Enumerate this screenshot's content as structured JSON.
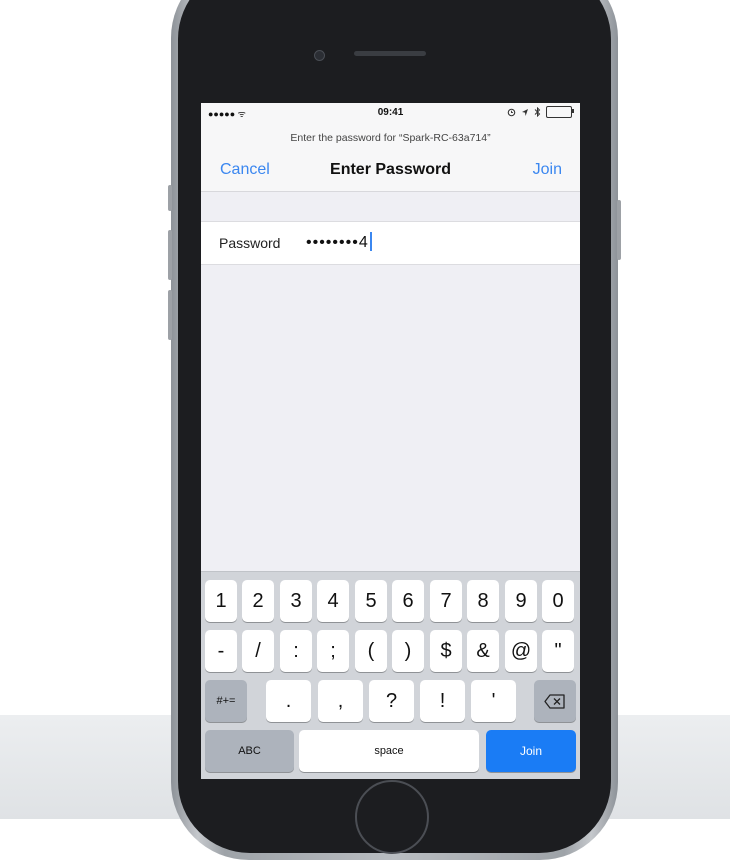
{
  "status_bar": {
    "signal": "●●●●● ᯤ",
    "time": "09:41",
    "icons": [
      "alarm-icon",
      "location-icon",
      "bluetooth-icon",
      "battery-icon"
    ],
    "battery_color": "#4cd964"
  },
  "header": {
    "prompt": "Enter the password for “Spark-RC-63a714”",
    "cancel_label": "Cancel",
    "title": "Enter Password",
    "join_label": "Join"
  },
  "form": {
    "password_label": "Password",
    "password_value": "••••••••4"
  },
  "keyboard": {
    "row1": [
      "1",
      "2",
      "3",
      "4",
      "5",
      "6",
      "7",
      "8",
      "9",
      "0"
    ],
    "row2": [
      "-",
      "/",
      ":",
      ";",
      "(",
      ")",
      "$",
      "&",
      "@",
      "\""
    ],
    "row3": {
      "symbols_key": "#+=",
      "keys": [
        ".",
        ",",
        "?",
        "!",
        "'"
      ],
      "delete_icon": "backspace-icon"
    },
    "row4": {
      "abc_label": "ABC",
      "space_label": "space",
      "join_label": "Join"
    }
  },
  "colors": {
    "accent": "#3b87f0",
    "join_key": "#1a7cf5",
    "keyboard_bg": "#d1d4d9",
    "screen_bg": "#efeff4"
  }
}
